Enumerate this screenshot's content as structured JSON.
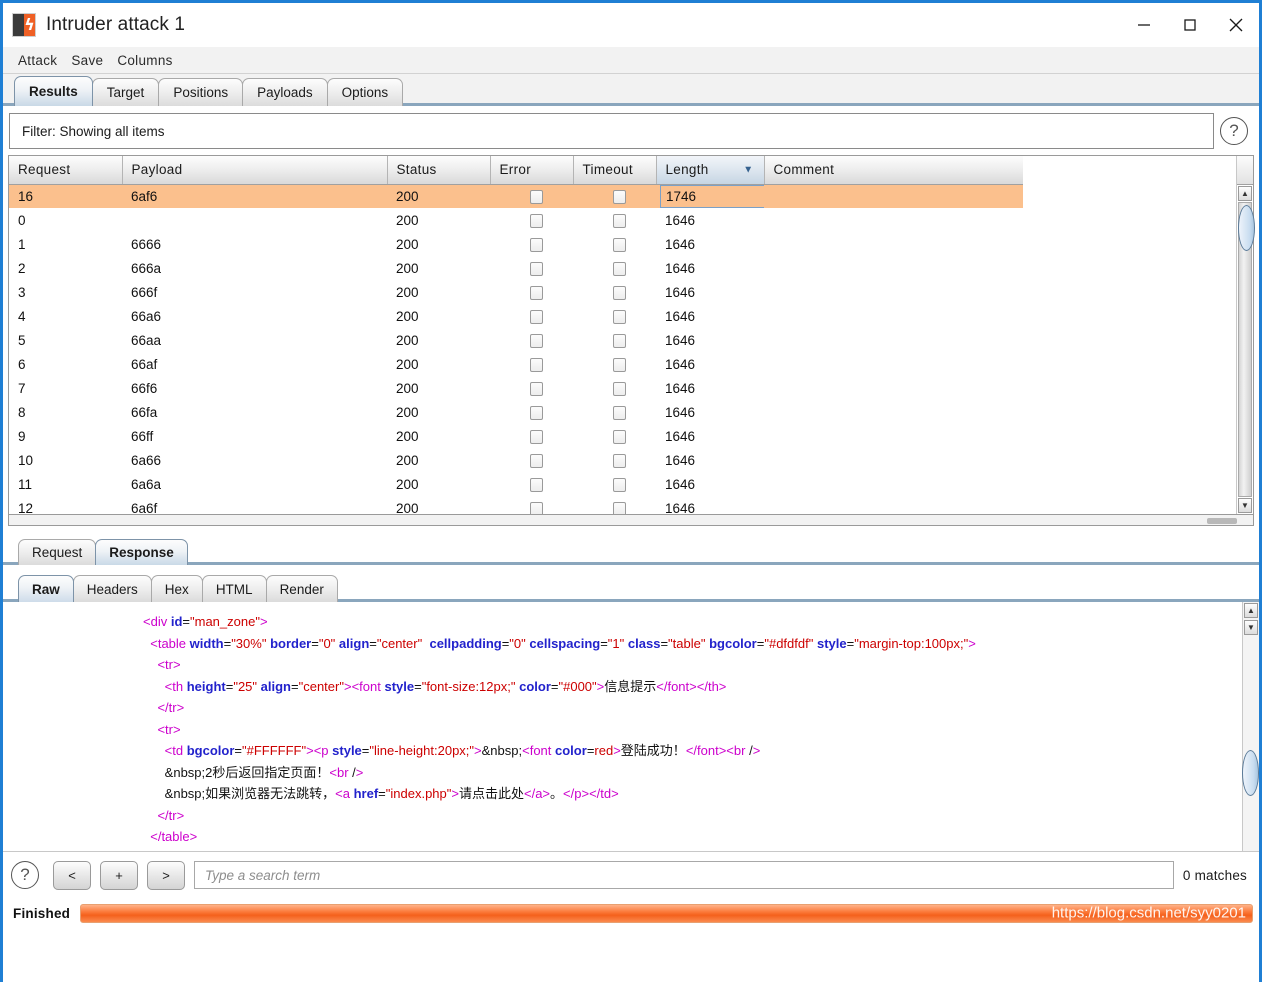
{
  "window": {
    "title": "Intruder attack 1",
    "logo_icon": "burp-suite-logo",
    "minimize_icon": "minimize-icon",
    "maximize_icon": "maximize-icon",
    "close_icon": "close-icon",
    "accent_border": "#1f7fd4"
  },
  "menubar": {
    "items": [
      "Attack",
      "Save",
      "Columns"
    ]
  },
  "main_tabs": [
    {
      "label": "Results",
      "active": true
    },
    {
      "label": "Target",
      "active": false
    },
    {
      "label": "Positions",
      "active": false
    },
    {
      "label": "Payloads",
      "active": false
    },
    {
      "label": "Options",
      "active": false
    }
  ],
  "filter": {
    "text": "Filter: Showing all items",
    "help_icon": "question-mark-icon"
  },
  "results_table": {
    "columns": [
      "Request",
      "Payload",
      "Status",
      "Error",
      "Timeout",
      "Length",
      "Comment"
    ],
    "sorted_column": "Length",
    "sort_direction_icon": "sort-descending-icon",
    "selected_row_index": 0,
    "selection_color": "#fbc08d",
    "rows": [
      {
        "request": "16",
        "payload": "6af6",
        "status": "200",
        "error": false,
        "timeout": false,
        "length": "1746",
        "comment": ""
      },
      {
        "request": "0",
        "payload": "",
        "status": "200",
        "error": false,
        "timeout": false,
        "length": "1646",
        "comment": ""
      },
      {
        "request": "1",
        "payload": "6666",
        "status": "200",
        "error": false,
        "timeout": false,
        "length": "1646",
        "comment": ""
      },
      {
        "request": "2",
        "payload": "666a",
        "status": "200",
        "error": false,
        "timeout": false,
        "length": "1646",
        "comment": ""
      },
      {
        "request": "3",
        "payload": "666f",
        "status": "200",
        "error": false,
        "timeout": false,
        "length": "1646",
        "comment": ""
      },
      {
        "request": "4",
        "payload": "66a6",
        "status": "200",
        "error": false,
        "timeout": false,
        "length": "1646",
        "comment": ""
      },
      {
        "request": "5",
        "payload": "66aa",
        "status": "200",
        "error": false,
        "timeout": false,
        "length": "1646",
        "comment": ""
      },
      {
        "request": "6",
        "payload": "66af",
        "status": "200",
        "error": false,
        "timeout": false,
        "length": "1646",
        "comment": ""
      },
      {
        "request": "7",
        "payload": "66f6",
        "status": "200",
        "error": false,
        "timeout": false,
        "length": "1646",
        "comment": ""
      },
      {
        "request": "8",
        "payload": "66fa",
        "status": "200",
        "error": false,
        "timeout": false,
        "length": "1646",
        "comment": ""
      },
      {
        "request": "9",
        "payload": "66ff",
        "status": "200",
        "error": false,
        "timeout": false,
        "length": "1646",
        "comment": ""
      },
      {
        "request": "10",
        "payload": "6a66",
        "status": "200",
        "error": false,
        "timeout": false,
        "length": "1646",
        "comment": ""
      },
      {
        "request": "11",
        "payload": "6a6a",
        "status": "200",
        "error": false,
        "timeout": false,
        "length": "1646",
        "comment": ""
      },
      {
        "request": "12",
        "payload": "6a6f",
        "status": "200",
        "error": false,
        "timeout": false,
        "length": "1646",
        "comment": ""
      }
    ]
  },
  "message_tabs": [
    {
      "label": "Request",
      "active": false
    },
    {
      "label": "Response",
      "active": true
    }
  ],
  "view_tabs": [
    {
      "label": "Raw",
      "active": true
    },
    {
      "label": "Headers",
      "active": false
    },
    {
      "label": "Hex",
      "active": false
    },
    {
      "label": "HTML",
      "active": false
    },
    {
      "label": "Render",
      "active": false
    }
  ],
  "response_body_lines": [
    "<div id=\"man_zone\">",
    "  <table width=\"30%\" border=\"0\" align=\"center\"  cellpadding=\"0\" cellspacing=\"1\" class=\"table\" bgcolor=\"#dfdfdf\" style=\"margin-top:100px;\">",
    "    <tr>",
    "      <th height=\"25\" align=\"center\"><font style=\"font-size:12px;\" color=\"#000\">信息提示</font></th>",
    "    </tr>",
    "    <tr>",
    "      <td bgcolor=\"#FFFFFF\"><p style=\"line-height:20px;\">&nbsp;<font color=red>登陆成功！</font><br />",
    "      &nbsp;2秒后返回指定页面！<br />",
    "      &nbsp;如果浏览器无法跳转，<a href=\"index.php\">请点击此处</a>。</p></td>",
    "    </tr>",
    "  </table>"
  ],
  "search_toolbar": {
    "help_icon": "question-mark-icon",
    "prev_label": "<",
    "add_label": "+",
    "next_label": ">",
    "placeholder": "Type a search term",
    "value": "",
    "matches_text": "0 matches"
  },
  "status_bar": {
    "label": "Finished",
    "progress_percent": 100,
    "progress_color": "#f4601c",
    "watermark": "https://blog.csdn.net/syy0201"
  }
}
